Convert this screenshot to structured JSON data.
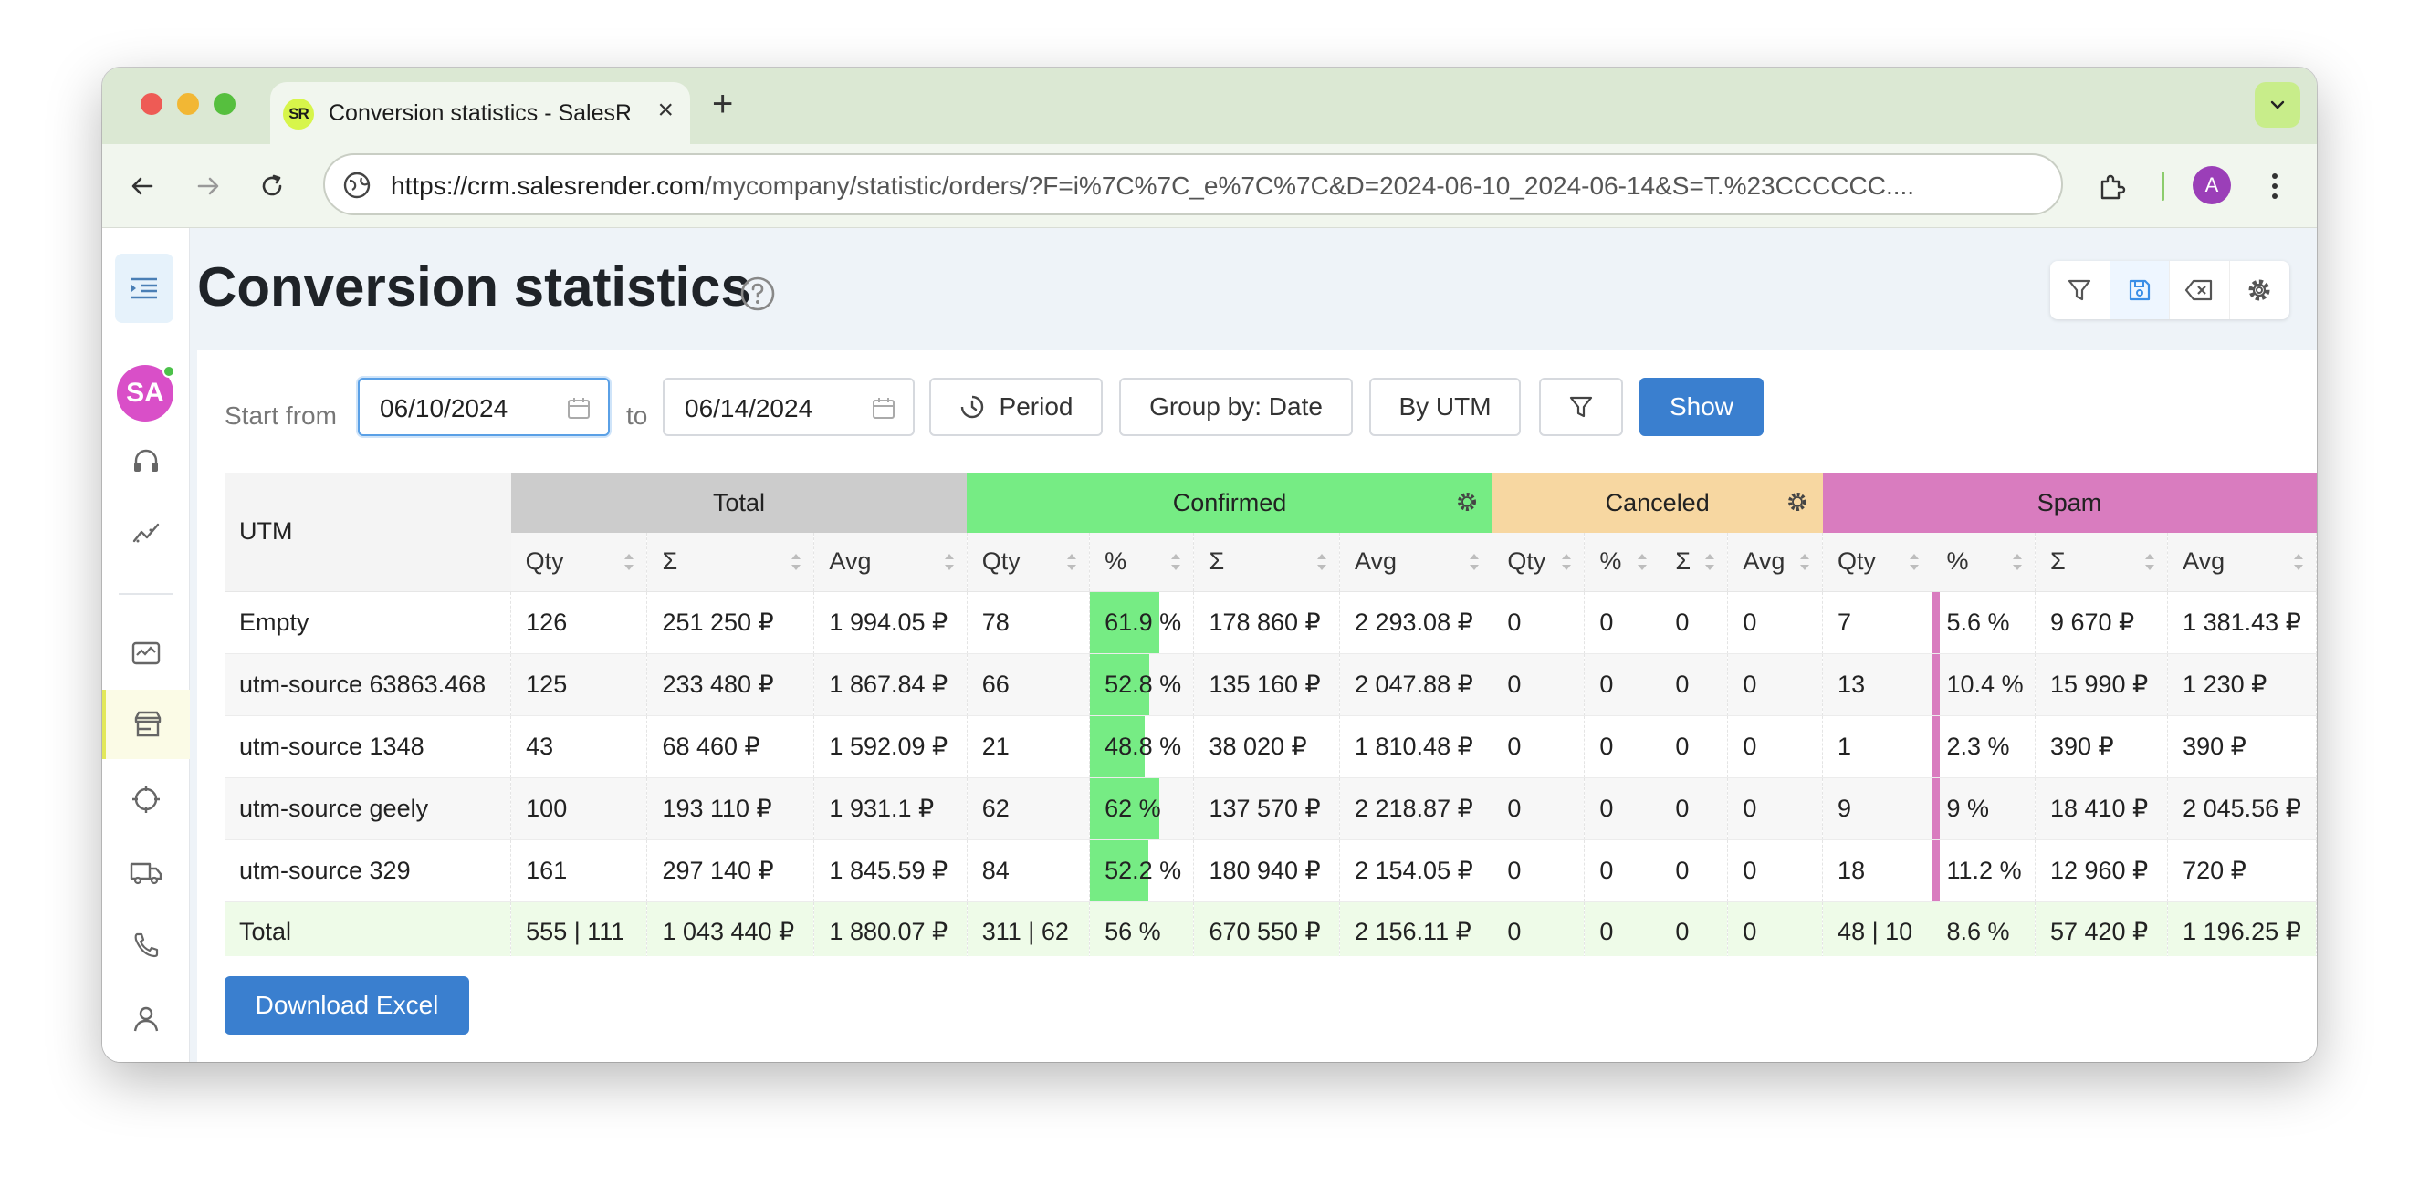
{
  "browser": {
    "tab_title": "Conversion statistics - SalesRender",
    "favicon_text": "SR",
    "url_host": "https://crm.salesrender.com",
    "url_path": "/mycompany/statistic/orders/?F=i%7C%7C_e%7C%7C&D=2024-06-10_2024-06-14&S=T.%23CCCCCC....",
    "profile_initial": "A"
  },
  "sidebar": {
    "avatar_initials": "SA",
    "items": [
      "support-icon",
      "analytics-icon",
      "dashboard-icon",
      "store-icon",
      "target-icon",
      "delivery-icon",
      "phone-icon",
      "user-icon"
    ],
    "active_item": "store-icon"
  },
  "page": {
    "title": "Conversion statistics"
  },
  "filters": {
    "start_label": "Start from",
    "start_date": "06/10/2024",
    "to_label": "to",
    "end_date": "06/14/2024",
    "period_label": "Period",
    "group_by_label": "Group by: Date",
    "by_utm_label": "By UTM",
    "show_label": "Show"
  },
  "table": {
    "utm_header": "UTM",
    "groups": [
      {
        "name": "Total",
        "color": "#cccccc",
        "gear": false
      },
      {
        "name": "Confirmed",
        "color": "#76ec84",
        "gear": true
      },
      {
        "name": "Canceled",
        "color": "#f7d7a1",
        "gear": true
      },
      {
        "name": "Spam",
        "color": "#d97cbf",
        "gear": false
      }
    ],
    "sub_headers": {
      "total": [
        "Qty",
        "Σ",
        "Avg"
      ],
      "confirmed": [
        "Qty",
        "%",
        "Σ",
        "Avg"
      ],
      "canceled": [
        "Qty",
        "%",
        "Σ",
        "Avg"
      ],
      "spam": [
        "Qty",
        "%",
        "Σ",
        "Avg"
      ]
    },
    "rows": [
      {
        "utm": "Empty",
        "t_qty": "126",
        "t_sum": "251 250 ₽",
        "t_avg": "1 994.05 ₽",
        "c_qty": "78",
        "c_pct": "61.9 %",
        "c_pct_val": 61.9,
        "c_sum": "178 860 ₽",
        "c_avg": "2 293.08 ₽",
        "x_qty": "0",
        "x_pct": "0",
        "x_sum": "0",
        "x_avg": "0",
        "s_qty": "7",
        "s_pct": "5.6 %",
        "s_pct_val": 5.6,
        "s_sum": "9 670 ₽",
        "s_avg": "1 381.43 ₽"
      },
      {
        "utm": "utm-source 63863.468",
        "t_qty": "125",
        "t_sum": "233 480 ₽",
        "t_avg": "1 867.84 ₽",
        "c_qty": "66",
        "c_pct": "52.8 %",
        "c_pct_val": 52.8,
        "c_sum": "135 160 ₽",
        "c_avg": "2 047.88 ₽",
        "x_qty": "0",
        "x_pct": "0",
        "x_sum": "0",
        "x_avg": "0",
        "s_qty": "13",
        "s_pct": "10.4 %",
        "s_pct_val": 10.4,
        "s_sum": "15 990 ₽",
        "s_avg": "1 230 ₽"
      },
      {
        "utm": "utm-source 1348",
        "t_qty": "43",
        "t_sum": "68 460 ₽",
        "t_avg": "1 592.09 ₽",
        "c_qty": "21",
        "c_pct": "48.8 %",
        "c_pct_val": 48.8,
        "c_sum": "38 020 ₽",
        "c_avg": "1 810.48 ₽",
        "x_qty": "0",
        "x_pct": "0",
        "x_sum": "0",
        "x_avg": "0",
        "s_qty": "1",
        "s_pct": "2.3 %",
        "s_pct_val": 2.3,
        "s_sum": "390 ₽",
        "s_avg": "390 ₽"
      },
      {
        "utm": "utm-source geely",
        "t_qty": "100",
        "t_sum": "193 110 ₽",
        "t_avg": "1 931.1 ₽",
        "c_qty": "62",
        "c_pct": "62 %",
        "c_pct_val": 62,
        "c_sum": "137 570 ₽",
        "c_avg": "2 218.87 ₽",
        "x_qty": "0",
        "x_pct": "0",
        "x_sum": "0",
        "x_avg": "0",
        "s_qty": "9",
        "s_pct": "9 %",
        "s_pct_val": 9,
        "s_sum": "18 410 ₽",
        "s_avg": "2 045.56 ₽"
      },
      {
        "utm": "utm-source 329",
        "t_qty": "161",
        "t_sum": "297 140 ₽",
        "t_avg": "1 845.59 ₽",
        "c_qty": "84",
        "c_pct": "52.2 %",
        "c_pct_val": 52.2,
        "c_sum": "180 940 ₽",
        "c_avg": "2 154.05 ₽",
        "x_qty": "0",
        "x_pct": "0",
        "x_sum": "0",
        "x_avg": "0",
        "s_qty": "18",
        "s_pct": "11.2 %",
        "s_pct_val": 11.2,
        "s_sum": "12 960 ₽",
        "s_avg": "720 ₽"
      }
    ],
    "total_row": {
      "utm": "Total",
      "t_qty": "555 | 111",
      "t_sum": "1 043 440 ₽",
      "t_avg": "1 880.07 ₽",
      "c_qty": "311 | 62",
      "c_pct": "56 %",
      "c_sum": "670 550 ₽",
      "c_avg": "2 156.11 ₽",
      "x_qty": "0",
      "x_pct": "0",
      "x_sum": "0",
      "x_avg": "0",
      "s_qty": "48 | 10",
      "s_pct": "8.6 %",
      "s_sum": "57 420 ₽",
      "s_avg": "1 196.25 ₽"
    }
  },
  "download_label": "Download Excel"
}
